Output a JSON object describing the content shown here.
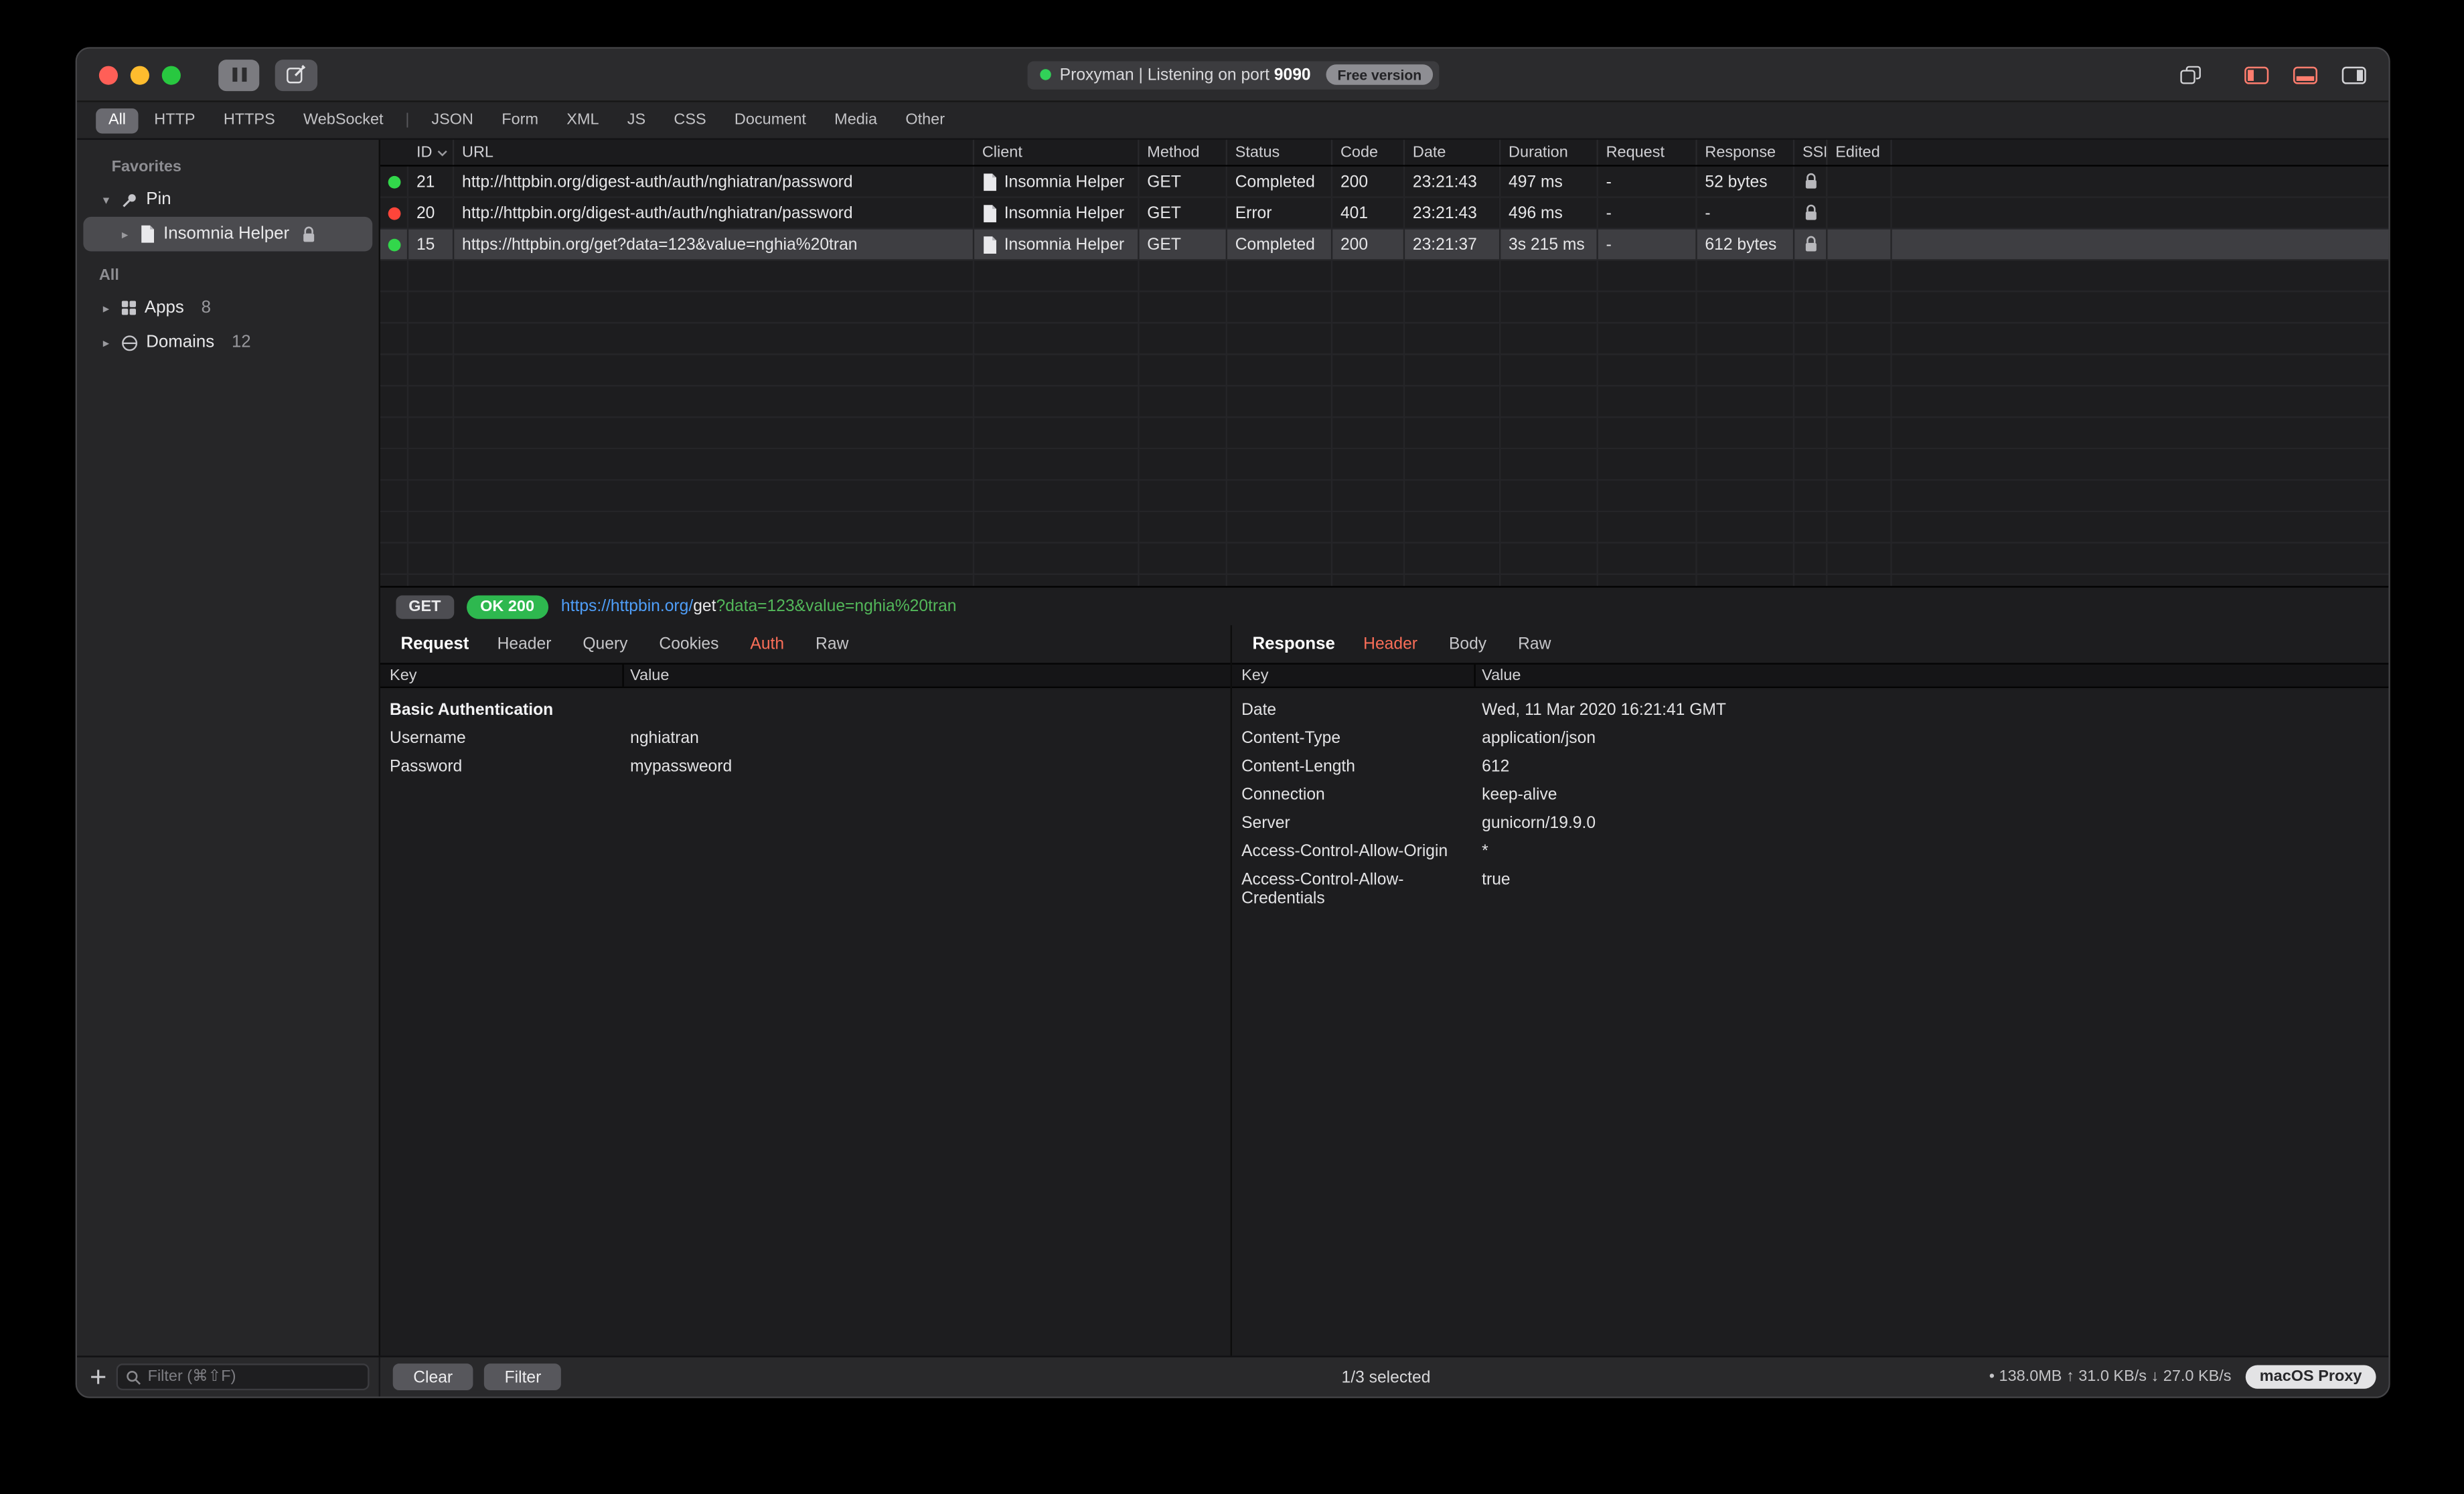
{
  "titlebar": {
    "status_text": "Proxyman | Listening on port ",
    "port": "9090",
    "free_badge": "Free version"
  },
  "filter_bar": {
    "group1": [
      "All",
      "HTTP",
      "HTTPS",
      "WebSocket"
    ],
    "separator": "|",
    "group2": [
      "JSON",
      "Form",
      "XML",
      "JS",
      "CSS",
      "Document",
      "Media",
      "Other"
    ],
    "active": "All"
  },
  "sidebar": {
    "favorites_label": "Favorites",
    "pin_label": "Pin",
    "pinned_app": "Insomnia Helper",
    "all_label": "All",
    "apps_label": "Apps",
    "apps_count": "8",
    "domains_label": "Domains",
    "domains_count": "12"
  },
  "table": {
    "headers": {
      "id": "ID",
      "url": "URL",
      "client": "Client",
      "method": "Method",
      "status": "Status",
      "code": "Code",
      "date": "Date",
      "duration": "Duration",
      "request": "Request",
      "response": "Response",
      "ssl": "SSL",
      "edited": "Edited"
    },
    "rows": [
      {
        "dot": "green",
        "id": "21",
        "url": "http://httpbin.org/digest-auth/auth/nghiatran/password",
        "client": "Insomnia Helper",
        "method": "GET",
        "status": "Completed",
        "code": "200",
        "date": "23:21:43",
        "duration": "497 ms",
        "request": "-",
        "response": "52 bytes",
        "edited": ""
      },
      {
        "dot": "red",
        "id": "20",
        "url": "http://httpbin.org/digest-auth/auth/nghiatran/password",
        "client": "Insomnia Helper",
        "method": "GET",
        "status": "Error",
        "code": "401",
        "date": "23:21:43",
        "duration": "496 ms",
        "request": "-",
        "response": "-",
        "edited": ""
      },
      {
        "dot": "green",
        "id": "15",
        "url": "https://httpbin.org/get?data=123&value=nghia%20tran",
        "client": "Insomnia Helper",
        "method": "GET",
        "status": "Completed",
        "code": "200",
        "date": "23:21:37",
        "duration": "3s 215 ms",
        "request": "-",
        "response": "612 bytes",
        "edited": ""
      }
    ]
  },
  "detail": {
    "method_badge": "GET",
    "status_badge": "OK 200",
    "url_host": "https://httpbin.org/",
    "url_path": "get",
    "url_query": "?data=123&value=nghia%20tran"
  },
  "request_pane": {
    "title": "Request",
    "tabs": [
      "Header",
      "Query",
      "Cookies",
      "Auth",
      "Raw"
    ],
    "active_tab": "Auth",
    "key_header": "Key",
    "value_header": "Value",
    "section": "Basic Authentication",
    "rows": [
      {
        "key": "Username",
        "value": "nghiatran"
      },
      {
        "key": "Password",
        "value": "mypassweord"
      }
    ]
  },
  "response_pane": {
    "title": "Response",
    "tabs": [
      "Header",
      "Body",
      "Raw"
    ],
    "active_tab": "Header",
    "key_header": "Key",
    "value_header": "Value",
    "rows": [
      {
        "key": "Date",
        "value": "Wed, 11 Mar 2020 16:21:41 GMT"
      },
      {
        "key": "Content-Type",
        "value": "application/json"
      },
      {
        "key": "Content-Length",
        "value": "612"
      },
      {
        "key": "Connection",
        "value": "keep-alive"
      },
      {
        "key": "Server",
        "value": "gunicorn/19.9.0"
      },
      {
        "key": "Access-Control-Allow-Origin",
        "value": "*"
      },
      {
        "key": "Access-Control-Allow-Credentials",
        "value": "true"
      }
    ]
  },
  "statusbar": {
    "filter_placeholder": "Filter (⌘⇧F)",
    "clear_button": "Clear",
    "filter_button": "Filter",
    "selection": "1/3 selected",
    "stats": "• 138.0MB ↑ 31.0 KB/s ↓ 27.0 KB/s",
    "proxy_badge": "macOS Proxy"
  },
  "colors": {
    "accent_tab": "#fa6e58",
    "success_green": "#32d74b",
    "error_red": "#ff453a",
    "badge_green": "#2eb84f",
    "link_blue": "#4f9ef8",
    "query_green": "#53b85a"
  }
}
